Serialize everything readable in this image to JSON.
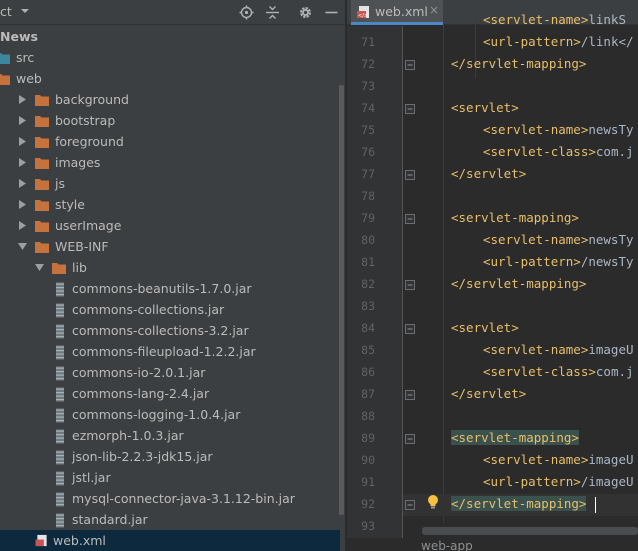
{
  "project_panel": {
    "title": "ct",
    "header_icons": [
      "crosshair-icon",
      "collapse-all-icon",
      "gear-icon",
      "minimize-icon"
    ],
    "tree": [
      {
        "label": "News",
        "bold": true,
        "indent": 0,
        "icon": "none",
        "arrow": "none"
      },
      {
        "label": "src",
        "indent": 0,
        "icon": "folder-blue",
        "arrow": "none"
      },
      {
        "label": "web",
        "indent": 0,
        "icon": "folder",
        "arrow": "none"
      },
      {
        "label": "background",
        "indent": 1,
        "icon": "folder",
        "arrow": "right"
      },
      {
        "label": "bootstrap",
        "indent": 1,
        "icon": "folder",
        "arrow": "right"
      },
      {
        "label": "foreground",
        "indent": 1,
        "icon": "folder",
        "arrow": "right"
      },
      {
        "label": "images",
        "indent": 1,
        "icon": "folder",
        "arrow": "right"
      },
      {
        "label": "js",
        "indent": 1,
        "icon": "folder",
        "arrow": "right"
      },
      {
        "label": "style",
        "indent": 1,
        "icon": "folder",
        "arrow": "right"
      },
      {
        "label": "userImage",
        "indent": 1,
        "icon": "folder",
        "arrow": "right"
      },
      {
        "label": "WEB-INF",
        "indent": 1,
        "icon": "folder",
        "arrow": "down"
      },
      {
        "label": "lib",
        "indent": 2,
        "icon": "folder",
        "arrow": "down"
      },
      {
        "label": "commons-beanutils-1.7.0.jar",
        "indent": 3,
        "icon": "jar",
        "arrow": "none"
      },
      {
        "label": "commons-collections.jar",
        "indent": 3,
        "icon": "jar",
        "arrow": "none"
      },
      {
        "label": "commons-collections-3.2.jar",
        "indent": 3,
        "icon": "jar",
        "arrow": "none"
      },
      {
        "label": "commons-fileupload-1.2.2.jar",
        "indent": 3,
        "icon": "jar",
        "arrow": "none"
      },
      {
        "label": "commons-io-2.0.1.jar",
        "indent": 3,
        "icon": "jar",
        "arrow": "none"
      },
      {
        "label": "commons-lang-2.4.jar",
        "indent": 3,
        "icon": "jar",
        "arrow": "none"
      },
      {
        "label": "commons-logging-1.0.4.jar",
        "indent": 3,
        "icon": "jar",
        "arrow": "none"
      },
      {
        "label": "ezmorph-1.0.3.jar",
        "indent": 3,
        "icon": "jar",
        "arrow": "none"
      },
      {
        "label": "json-lib-2.2.3-jdk15.jar",
        "indent": 3,
        "icon": "jar",
        "arrow": "none"
      },
      {
        "label": "jstl.jar",
        "indent": 3,
        "icon": "jar",
        "arrow": "none"
      },
      {
        "label": "mysql-connector-java-3.1.12-bin.jar",
        "indent": 3,
        "icon": "jar",
        "arrow": "none"
      },
      {
        "label": "standard.jar",
        "indent": 3,
        "icon": "jar",
        "arrow": "none"
      },
      {
        "label": "web.xml",
        "indent": 2,
        "icon": "xml",
        "arrow": "none",
        "selected": true
      }
    ]
  },
  "editor": {
    "tab": {
      "label": "web.xml",
      "close": "×"
    },
    "lines": [
      {
        "n": "71",
        "indent": 2,
        "parts": [
          [
            "tag",
            "<url-pattern>"
          ],
          [
            "txt",
            "/link</"
          ]
        ]
      },
      {
        "n": "72",
        "indent": 1,
        "fold": true,
        "parts": [
          [
            "tag",
            "</servlet-mapping>"
          ]
        ]
      },
      {
        "n": "73",
        "indent": 0,
        "parts": []
      },
      {
        "n": "74",
        "indent": 1,
        "fold": true,
        "parts": [
          [
            "tag",
            "<servlet>"
          ]
        ]
      },
      {
        "n": "75",
        "indent": 2,
        "parts": [
          [
            "tag",
            "<servlet-name>"
          ],
          [
            "txt",
            "newsTy"
          ]
        ]
      },
      {
        "n": "76",
        "indent": 2,
        "parts": [
          [
            "tag",
            "<servlet-class>"
          ],
          [
            "txt",
            "com.j"
          ]
        ]
      },
      {
        "n": "77",
        "indent": 1,
        "fold": true,
        "parts": [
          [
            "tag",
            "</servlet>"
          ]
        ]
      },
      {
        "n": "78",
        "indent": 0,
        "parts": []
      },
      {
        "n": "79",
        "indent": 1,
        "fold": true,
        "parts": [
          [
            "tag",
            "<servlet-mapping>"
          ]
        ]
      },
      {
        "n": "80",
        "indent": 2,
        "parts": [
          [
            "tag",
            "<servlet-name>"
          ],
          [
            "txt",
            "newsTy"
          ]
        ]
      },
      {
        "n": "81",
        "indent": 2,
        "parts": [
          [
            "tag",
            "<url-pattern>"
          ],
          [
            "txt",
            "/newsTy"
          ]
        ]
      },
      {
        "n": "82",
        "indent": 1,
        "fold": true,
        "parts": [
          [
            "tag",
            "</servlet-mapping>"
          ]
        ]
      },
      {
        "n": "83",
        "indent": 0,
        "parts": []
      },
      {
        "n": "84",
        "indent": 1,
        "fold": true,
        "parts": [
          [
            "tag",
            "<servlet>"
          ]
        ]
      },
      {
        "n": "85",
        "indent": 2,
        "parts": [
          [
            "tag",
            "<servlet-name>"
          ],
          [
            "txt",
            "imageU"
          ]
        ]
      },
      {
        "n": "86",
        "indent": 2,
        "parts": [
          [
            "tag",
            "<servlet-class>"
          ],
          [
            "txt",
            "com.j"
          ]
        ]
      },
      {
        "n": "87",
        "indent": 1,
        "fold": true,
        "parts": [
          [
            "tag",
            "</servlet>"
          ]
        ]
      },
      {
        "n": "88",
        "indent": 0,
        "parts": []
      },
      {
        "n": "89",
        "indent": 1,
        "fold": true,
        "highlight_tag": true,
        "parts": [
          [
            "tag",
            "<servlet-mapping>"
          ]
        ]
      },
      {
        "n": "90",
        "indent": 2,
        "parts": [
          [
            "tag",
            "<servlet-name>"
          ],
          [
            "txt",
            "imageU"
          ]
        ]
      },
      {
        "n": "91",
        "indent": 2,
        "parts": [
          [
            "tag",
            "<url-pattern>"
          ],
          [
            "txt",
            "/imageU"
          ]
        ]
      },
      {
        "n": "92",
        "indent": 1,
        "fold": true,
        "current": true,
        "highlight_tag": true,
        "parts": [
          [
            "tag",
            "</servlet-mapping>"
          ]
        ]
      },
      {
        "n": "93",
        "indent": 0,
        "parts": []
      }
    ],
    "top_partial": [
      [
        "tag",
        "<servlet-name>"
      ],
      [
        "txt",
        "linkS"
      ]
    ],
    "breadcrumb": "web-app",
    "colors": {
      "tag": "#e8bf6a",
      "text": "#a9b7c6",
      "background": "#2b2b2b",
      "selection": "#0d293e"
    }
  }
}
